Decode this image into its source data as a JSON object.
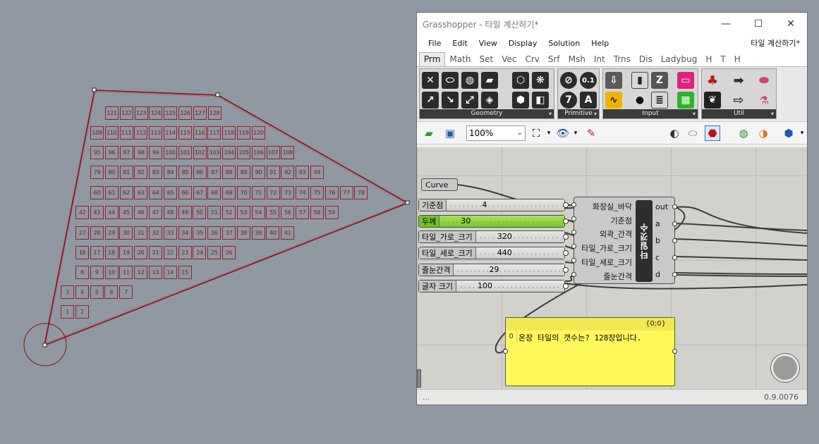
{
  "viewport": {
    "tiles": [
      {
        "rows": [
          "121",
          "122",
          "123",
          "124",
          "125",
          "126",
          "127",
          "128"
        ]
      },
      {
        "rows": [
          "109",
          "110",
          "111",
          "112",
          "113",
          "114",
          "115",
          "116",
          "117",
          "118",
          "119",
          "120"
        ]
      },
      {
        "rows": [
          "95",
          "96",
          "97",
          "98",
          "99",
          "100",
          "101",
          "102",
          "103",
          "104",
          "105",
          "106",
          "107",
          "108"
        ]
      },
      {
        "rows": [
          "79",
          "80",
          "81",
          "82",
          "83",
          "84",
          "85",
          "86",
          "87",
          "88",
          "89",
          "90",
          "91",
          "92",
          "93",
          "94"
        ]
      },
      {
        "rows": [
          "60",
          "61",
          "62",
          "63",
          "64",
          "65",
          "66",
          "67",
          "68",
          "69",
          "70",
          "71",
          "72",
          "73",
          "74",
          "75",
          "76",
          "77",
          "78"
        ]
      },
      {
        "rows": [
          "42",
          "43",
          "44",
          "45",
          "46",
          "47",
          "48",
          "49",
          "50",
          "51",
          "52",
          "53",
          "54",
          "55",
          "56",
          "57",
          "58",
          "59"
        ]
      },
      {
        "rows": [
          "27",
          "28",
          "29",
          "30",
          "31",
          "32",
          "33",
          "34",
          "35",
          "36",
          "37",
          "38",
          "39",
          "40",
          "41"
        ]
      },
      {
        "rows": [
          "16",
          "17",
          "18",
          "19",
          "20",
          "21",
          "22",
          "23",
          "24",
          "25",
          "26"
        ]
      },
      {
        "rows": [
          "8",
          "9",
          "10",
          "11",
          "12",
          "13",
          "14",
          "15"
        ]
      },
      {
        "rows": [
          "3",
          "4",
          "5",
          "6",
          "7"
        ]
      },
      {
        "rows": [
          "1",
          "2"
        ]
      }
    ]
  },
  "window": {
    "title": "Grasshopper - 타일 계산하기*",
    "controls": {
      "minimize": "—",
      "maximize": "☐",
      "close": "✕"
    },
    "menu": [
      "File",
      "Edit",
      "View",
      "Display",
      "Solution",
      "Help"
    ],
    "document_name": "타일 계산하기*",
    "tabs": [
      "Prm",
      "Math",
      "Set",
      "Vec",
      "Crv",
      "Srf",
      "Msh",
      "Int",
      "Trns",
      "Dis",
      "Ladybug",
      "H",
      "T",
      "H"
    ],
    "active_tab": "Prm",
    "ribbon_groups": [
      "Geometry",
      "Primitive",
      "Input",
      "Util"
    ],
    "zoom": "100%"
  },
  "canvas": {
    "curve_param": "Curve",
    "sliders": [
      {
        "label": "기준점",
        "value": "4"
      },
      {
        "label": "두께",
        "value": "30"
      },
      {
        "label": "타일_가로_크기",
        "value": "320"
      },
      {
        "label": "타일_세로_크기",
        "value": "440"
      },
      {
        "label": "줄눈간격",
        "value": "29"
      },
      {
        "label": "글자 크기",
        "value": "100"
      }
    ],
    "component": {
      "name": "타일갯수",
      "inputs": [
        "화장실_바닥",
        "기준점",
        "외곽_간격",
        "타일_가로_크기",
        "타일_세로_크기",
        "줄눈간격"
      ],
      "outputs": [
        "out",
        "a",
        "b",
        "c",
        "d"
      ]
    },
    "panel": {
      "header": "{0;0}",
      "index": "0",
      "text": "온장 타일의 갯수는? 128장입니다."
    }
  },
  "statusbar": {
    "left": "...",
    "version": "0.9.0076"
  }
}
